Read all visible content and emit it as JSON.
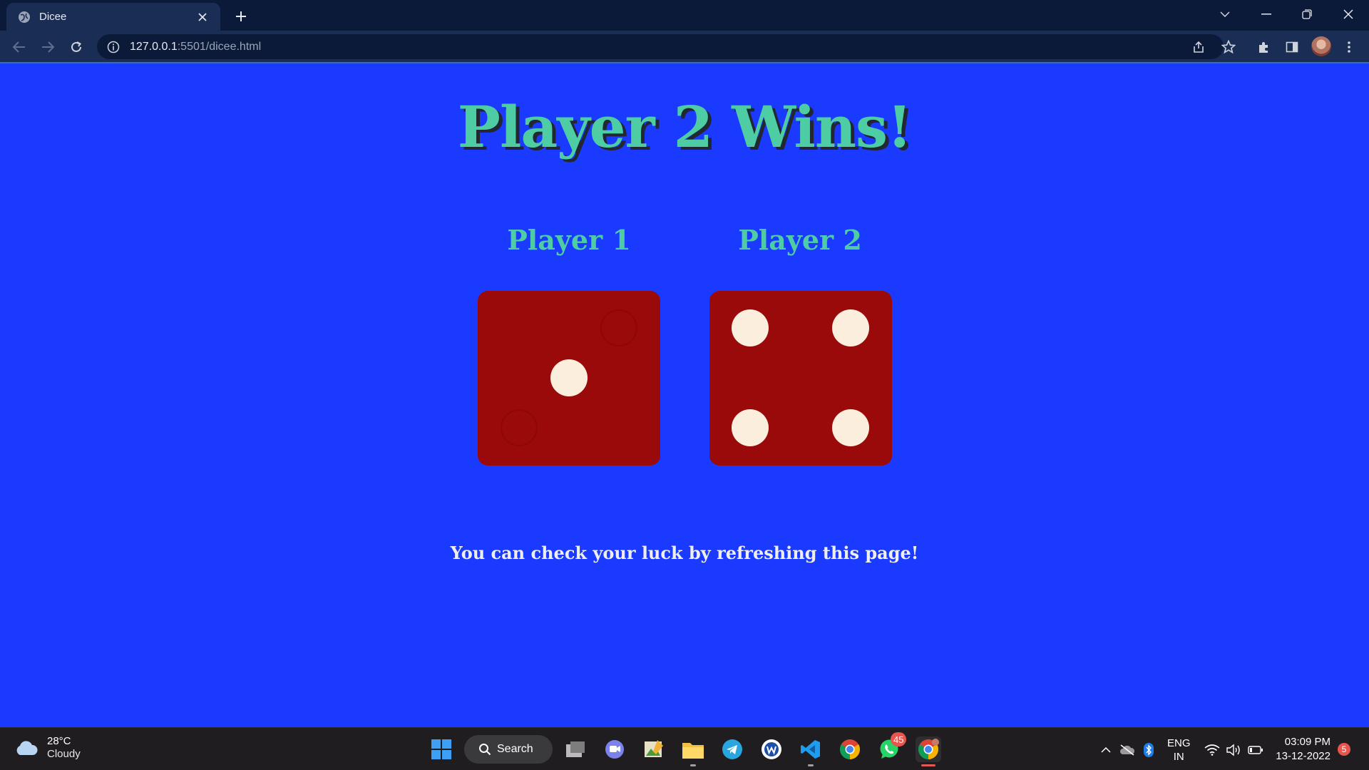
{
  "browser": {
    "tab_title": "Dicee",
    "url_host": "127.0.0.1",
    "url_path": ":5501/dicee.html"
  },
  "page": {
    "headline": "Player 2 Wins!",
    "players": [
      {
        "label": "Player 1",
        "die_value": 1
      },
      {
        "label": "Player 2",
        "die_value": 4
      }
    ],
    "footer": "You can check your luck by refreshing this page!",
    "colors": {
      "background": "#1a3aff",
      "title": "#4ecca3",
      "die": "#9b0a0a",
      "pip": "#fbeedc",
      "footer": "#eeeeee"
    }
  },
  "taskbar": {
    "weather": {
      "temp": "28°C",
      "condition": "Cloudy",
      "icon": "cloud-icon"
    },
    "search_label": "Search",
    "apps": [
      {
        "name": "start-icon"
      },
      {
        "name": "task-view-icon"
      },
      {
        "name": "chat-icon"
      },
      {
        "name": "photo-editor-icon"
      },
      {
        "name": "file-explorer-icon"
      },
      {
        "name": "telegram-icon"
      },
      {
        "name": "app-w-icon"
      },
      {
        "name": "vscode-icon"
      },
      {
        "name": "chrome-icon"
      },
      {
        "name": "whatsapp-icon",
        "badge": "45"
      },
      {
        "name": "chrome-active-icon"
      }
    ],
    "lang": {
      "line1": "ENG",
      "line2": "IN"
    },
    "clock": {
      "time": "03:09 PM",
      "date": "13-12-2022"
    },
    "notifications": "5"
  }
}
